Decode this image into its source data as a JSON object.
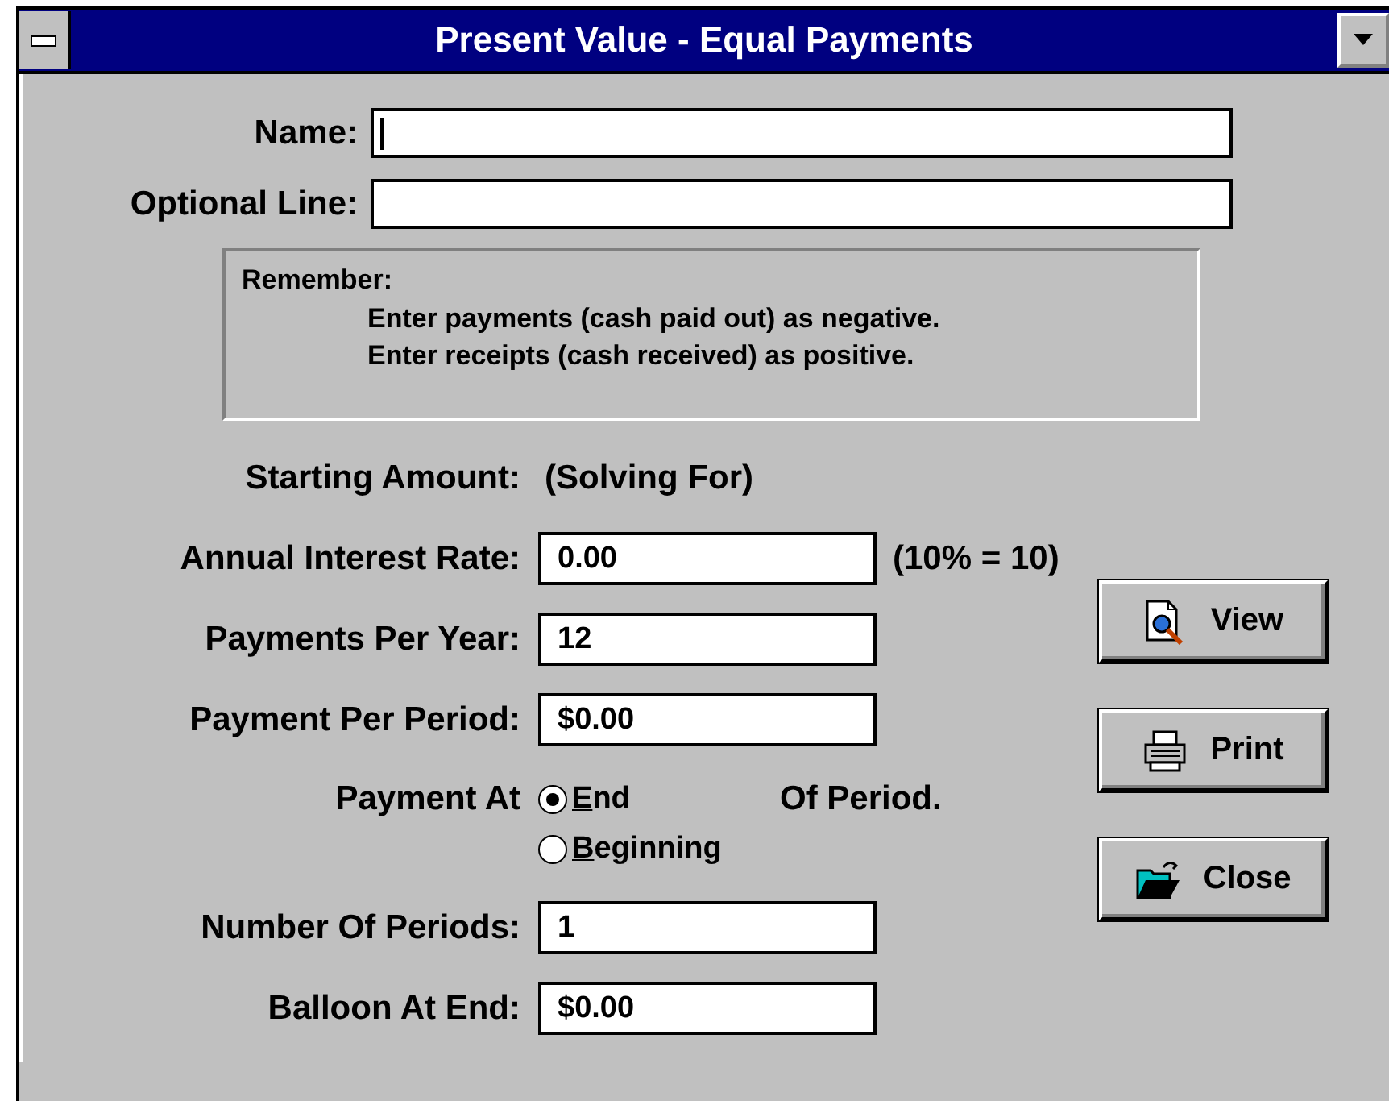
{
  "window": {
    "title": "Present Value - Equal Payments"
  },
  "header_fields": [
    {
      "label": "Name:",
      "focused": true
    },
    {
      "label": "Optional Line:",
      "focused": false
    }
  ],
  "notice": {
    "heading": "Remember:",
    "lines": [
      "Enter payments (cash paid out) as negative.",
      "Enter receipts (cash received) as positive."
    ]
  },
  "rows": [
    {
      "kind": "text",
      "label": "Starting Amount:",
      "value": "(Solving For)"
    },
    {
      "kind": "field",
      "label": "Annual Interest Rate:",
      "value": "0.00",
      "note": "(10% = 10)"
    },
    {
      "kind": "field",
      "label": "Payments Per Year:",
      "value": "12"
    },
    {
      "kind": "field",
      "label": "Payment Per Period:",
      "value": "$0.00"
    },
    {
      "kind": "radio",
      "label": "Payment At",
      "suffix": "Of Period.",
      "options": [
        {
          "label": "End",
          "selected": true
        },
        {
          "label": "Beginning",
          "selected": false
        }
      ]
    },
    {
      "kind": "field",
      "label": "Number Of Periods:",
      "value": "1"
    },
    {
      "kind": "field",
      "label": "Balloon At End:",
      "value": "$0.00"
    }
  ],
  "buttons": [
    {
      "label": "View",
      "kind": "view"
    },
    {
      "label": "Print",
      "kind": "print"
    },
    {
      "label": "Close",
      "kind": "close"
    }
  ]
}
